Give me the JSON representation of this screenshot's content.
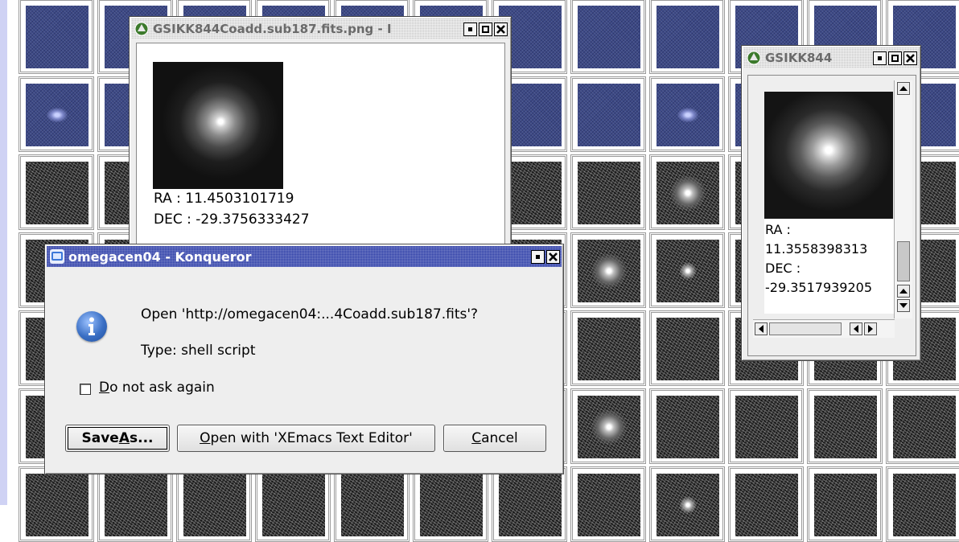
{
  "colors": {
    "accent_titlebar": "#2f3fa8",
    "info_icon": "#3a6fc4",
    "desktop_strip": "#cfd2f4"
  },
  "image_window_1": {
    "title": "GSIKK844Coadd.sub187.fits.png - I",
    "ra_text": "RA : 11.4503101719",
    "dec_text": "DEC : -29.3756333427"
  },
  "image_window_2": {
    "title": "GSIKK844",
    "ra_label": "RA :",
    "ra_value": "11.3558398313",
    "dec_label": "DEC :",
    "dec_value": "-29.3517939205"
  },
  "dialog": {
    "title": "omegacen04 - Konqueror",
    "message": "Open 'http://omegacen04:...4Coadd.sub187.fits'?",
    "type_line": "Type: shell script",
    "checkbox_label_first": "D",
    "checkbox_label_rest": "o not ask again",
    "checkbox_checked": false,
    "save_as_first": "Save ",
    "save_as_mnemonic": "A",
    "save_as_rest": "s...",
    "open_with_first": "O",
    "open_with_rest": "pen with 'XEmacs Text Editor'",
    "cancel_first": "C",
    "cancel_rest": "ancel",
    "icon": "info-icon"
  },
  "window_buttons": [
    "minimize-icon",
    "maximize-icon",
    "close-icon"
  ]
}
